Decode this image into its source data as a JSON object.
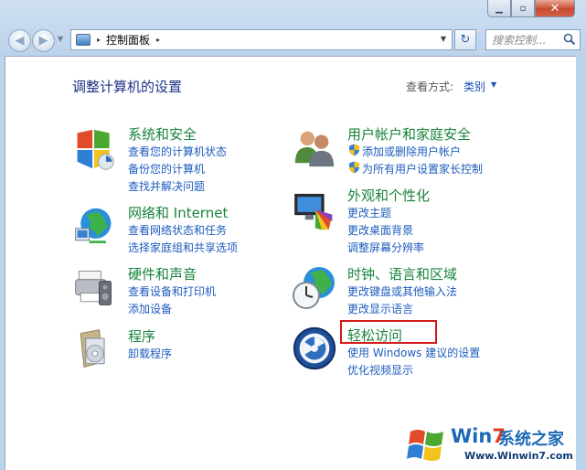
{
  "window": {
    "caption": {
      "min_icon": "minimize-icon",
      "max_icon": "maximize-icon",
      "close_icon": "close-icon"
    }
  },
  "nav": {
    "address_sep": "▸",
    "address": "控制面板",
    "address_sep2": "▸",
    "search_placeholder": "搜索控制...",
    "back_glyph": "◀",
    "forward_glyph": "▶",
    "dropdown_glyph": "▼",
    "refresh_glyph": "↻"
  },
  "main": {
    "title": "调整计算机的设置",
    "view_by_label": "查看方式:",
    "view_by_value": "类别",
    "view_by_arrow": "▼"
  },
  "categories": [
    {
      "title": "系统和安全",
      "icon": "system-security-icon",
      "links": [
        "查看您的计算机状态",
        "备份您的计算机",
        "查找并解决问题"
      ]
    },
    {
      "title": "网络和 Internet",
      "icon": "network-internet-icon",
      "links": [
        "查看网络状态和任务",
        "选择家庭组和共享选项"
      ]
    },
    {
      "title": "硬件和声音",
      "icon": "hardware-sound-icon",
      "links": [
        "查看设备和打印机",
        "添加设备"
      ]
    },
    {
      "title": "程序",
      "icon": "programs-icon",
      "links": [
        "卸载程序"
      ]
    },
    {
      "title": "用户帐户和家庭安全",
      "icon": "user-accounts-icon",
      "links": [
        "添加或删除用户帐户",
        "为所有用户设置家长控制"
      ]
    },
    {
      "title": "外观和个性化",
      "icon": "appearance-icon",
      "links": [
        "更改主题",
        "更改桌面背景",
        "调整屏幕分辨率"
      ]
    },
    {
      "title": "时钟、语言和区域",
      "icon": "clock-language-icon",
      "links": [
        "更改键盘或其他输入法",
        "更改显示语言"
      ]
    },
    {
      "title": "轻松访问",
      "icon": "ease-of-access-icon",
      "links": [
        "使用 Windows 建议的设置",
        "优化视频显示"
      ]
    }
  ],
  "watermark": {
    "brand_prefix": "Win",
    "brand_seven": "7",
    "brand_cn": "系统之家",
    "url": "Www.Winwin7.com"
  },
  "colors": {
    "category_title": "#18833b",
    "link": "#1d5cbe",
    "page_title": "#1e3287",
    "highlight": "#d41a1a"
  }
}
